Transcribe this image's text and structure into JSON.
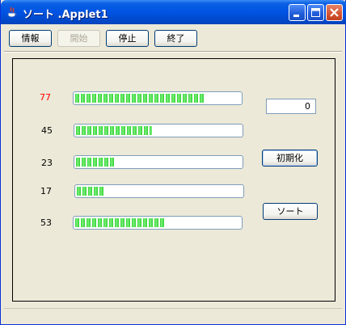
{
  "window": {
    "title": "ソート .Applet1",
    "title_separator": " ",
    "controls": [
      "minimize-icon",
      "maximize-icon",
      "close-icon"
    ]
  },
  "toolbar": {
    "info_label": "情報",
    "start_label": "開始",
    "stop_label": "停止",
    "exit_label": "終了"
  },
  "rows": [
    {
      "value": "77",
      "fill_fraction": 0.77,
      "highlighted": true
    },
    {
      "value": "45",
      "fill_fraction": 0.45,
      "highlighted": false
    },
    {
      "value": "23",
      "fill_fraction": 0.23,
      "highlighted": false
    },
    {
      "value": "17",
      "fill_fraction": 0.17,
      "highlighted": false
    },
    {
      "value": "53",
      "fill_fraction": 0.53,
      "highlighted": false
    }
  ],
  "counter": {
    "value": "0"
  },
  "actions": {
    "reset_label": "初期化",
    "sort_label": "ソート"
  },
  "colors": {
    "highlight": "#ff0000",
    "bar_fill": "#2fd12f",
    "titlebar": "#0054e3"
  }
}
